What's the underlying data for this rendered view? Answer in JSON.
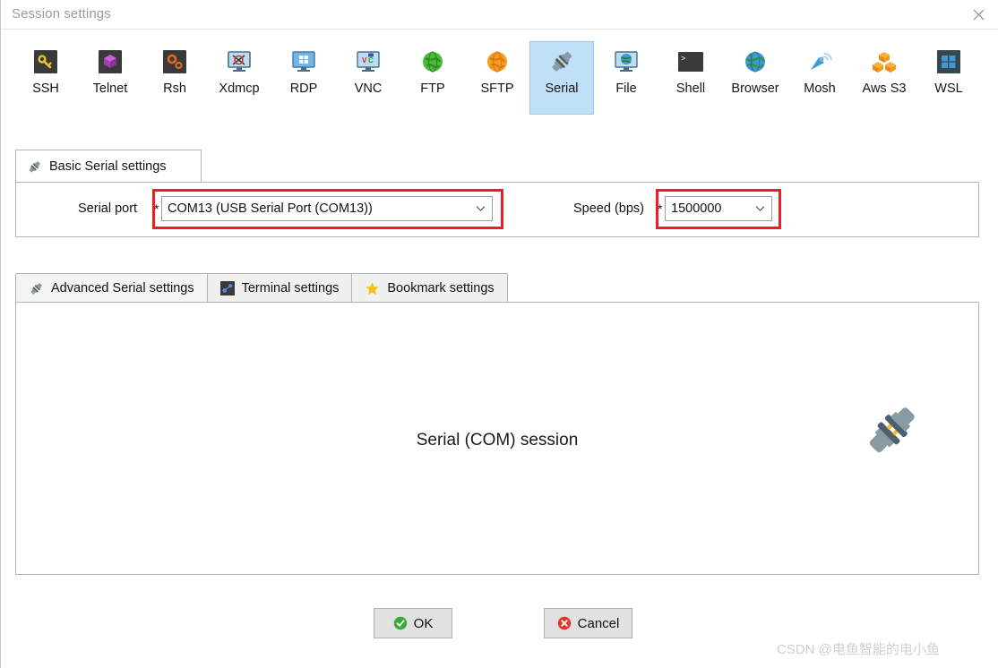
{
  "window": {
    "title": "Session settings",
    "close_icon": "close-icon"
  },
  "toolbar": {
    "items": [
      {
        "label": "SSH",
        "icon": "key-icon",
        "selected": false
      },
      {
        "label": "Telnet",
        "icon": "cube-icon",
        "selected": false
      },
      {
        "label": "Rsh",
        "icon": "gears-icon",
        "selected": false
      },
      {
        "label": "Xdmcp",
        "icon": "x-monitor-icon",
        "selected": false
      },
      {
        "label": "RDP",
        "icon": "windows-monitor-icon",
        "selected": false
      },
      {
        "label": "VNC",
        "icon": "vnc-monitor-icon",
        "selected": false
      },
      {
        "label": "FTP",
        "icon": "green-globe-icon",
        "selected": false
      },
      {
        "label": "SFTP",
        "icon": "orange-globe-icon",
        "selected": false
      },
      {
        "label": "Serial",
        "icon": "plug-icon",
        "selected": true
      },
      {
        "label": "File",
        "icon": "globe-monitor-icon",
        "selected": false
      },
      {
        "label": "Shell",
        "icon": "terminal-icon",
        "selected": false
      },
      {
        "label": "Browser",
        "icon": "blue-globe-icon",
        "selected": false
      },
      {
        "label": "Mosh",
        "icon": "satellite-icon",
        "selected": false
      },
      {
        "label": "Aws S3",
        "icon": "aws-cubes-icon",
        "selected": false
      },
      {
        "label": "WSL",
        "icon": "windows-icon",
        "selected": false
      }
    ]
  },
  "basic_tab": {
    "label": "Basic Serial settings",
    "icon": "plug-icon"
  },
  "basic_panel": {
    "serial_port": {
      "label": "Serial port",
      "required_mark": "*",
      "value": "COM13  (USB Serial Port (COM13))",
      "highlighted": true
    },
    "speed": {
      "label": "Speed (bps)",
      "required_mark": "*",
      "value": "1500000",
      "highlighted": true
    }
  },
  "sub_tabs": [
    {
      "label": "Advanced Serial settings",
      "icon": "plug-icon",
      "selected": true
    },
    {
      "label": "Terminal settings",
      "icon": "nodes-icon",
      "selected": false
    },
    {
      "label": "Bookmark settings",
      "icon": "star-icon",
      "selected": false
    }
  ],
  "main_panel": {
    "session_title": "Serial (COM) session",
    "illustration_icon": "plug-icon"
  },
  "footer": {
    "ok_label": "OK",
    "ok_icon": "check-circle-icon",
    "cancel_label": "Cancel",
    "cancel_icon": "x-circle-icon"
  },
  "watermark": {
    "text": "CSDN @电鱼智能的电小鱼"
  },
  "colors": {
    "highlight_red": "#ee1c25",
    "tab_selected_blue": "#bfe0f7",
    "ok_green": "#3aa93a",
    "cancel_red": "#e5352b"
  }
}
